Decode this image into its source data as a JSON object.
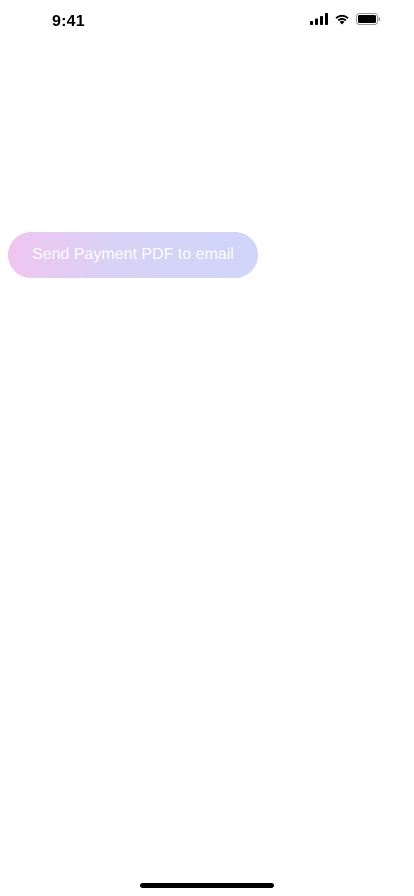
{
  "status_bar": {
    "time": "9:41",
    "icons": [
      "cellular-signal-icon",
      "wifi-icon",
      "battery-icon"
    ]
  },
  "main": {
    "send_button_label": "Send Payment PDF to email"
  },
  "colors": {
    "button_gradient_start": "#efc6f0",
    "button_gradient_end": "#cfd5fa",
    "button_text": "#ffffff",
    "background": "#ffffff"
  }
}
